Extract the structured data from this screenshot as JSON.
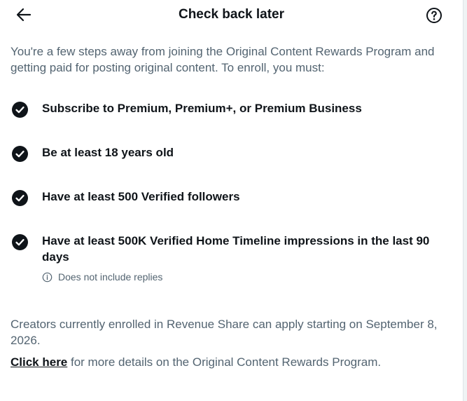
{
  "header": {
    "title": "Check back later",
    "back_icon": "arrow-left-icon",
    "help_icon": "question-circle-icon"
  },
  "intro": "You're a few steps away from joining the Original Content Rewards Program and getting paid for posting original content. To enroll, you must:",
  "requirements": [
    {
      "label": "Subscribe to Premium, Premium+, or Premium Business",
      "icon": "check-circle-icon"
    },
    {
      "label": "Be at least 18 years old",
      "icon": "check-circle-icon"
    },
    {
      "label": "Have at least 500 Verified followers",
      "icon": "check-circle-icon"
    },
    {
      "label": "Have at least 500K Verified Home Timeline impressions in the last 90 days",
      "icon": "check-circle-icon"
    }
  ],
  "note": {
    "icon": "info-circle-icon",
    "text": "Does not include replies"
  },
  "footer": {
    "revenue_share": "Creators currently enrolled in Revenue Share can apply starting on September 8, 2026.",
    "link_label": "Click here",
    "link_suffix": " for more details on the Original Content Rewards Program."
  },
  "colors": {
    "primary_text": "#0f1419",
    "secondary_text": "#536471",
    "background": "#ffffff"
  }
}
